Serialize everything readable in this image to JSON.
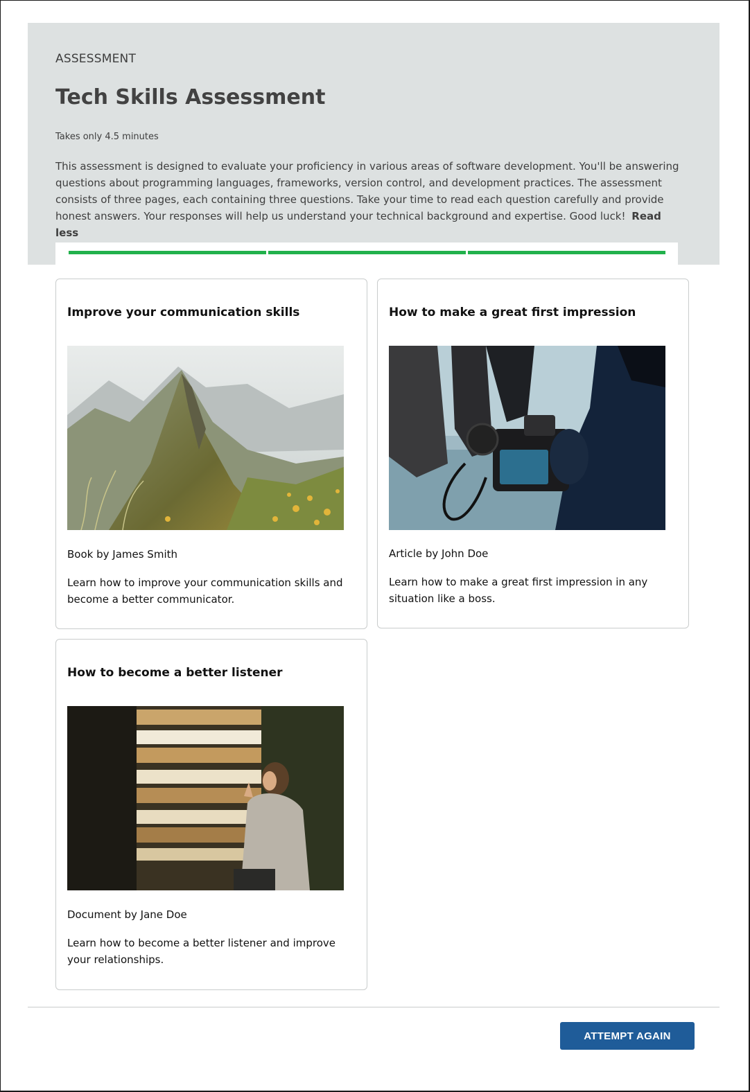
{
  "header": {
    "eyebrow": "ASSESSMENT",
    "title": "Tech Skills Assessment",
    "duration": "Takes only 4.5 minutes",
    "description": "This assessment is designed to evaluate your proficiency in various areas of software development. You'll be answering questions about programming languages, frameworks, version control, and development practices. The assessment consists of three pages, each containing three questions. Take your time to read each question carefully and provide honest answers. Your responses will help us understand your technical background and expertise. Good luck!",
    "read_less": "Read less"
  },
  "progress": {
    "segments_total": 3,
    "segments_complete": 3,
    "color": "#22b14c"
  },
  "cards": [
    {
      "title": "Improve your communication skills",
      "meta": "Book by James Smith",
      "description": "Learn how to improve your communication skills and become a better communicator."
    },
    {
      "title": "How to make a great first impression",
      "meta": "Article by John Doe",
      "description": "Learn how to make a great first impression in any situation like a boss."
    },
    {
      "title": "How to become a better listener",
      "meta": "Document by Jane Doe",
      "description": "Learn how to become a better listener and improve your relationships."
    }
  ],
  "footer": {
    "attempt_again_label": "ATTEMPT AGAIN",
    "button_color": "#1f5c99"
  }
}
